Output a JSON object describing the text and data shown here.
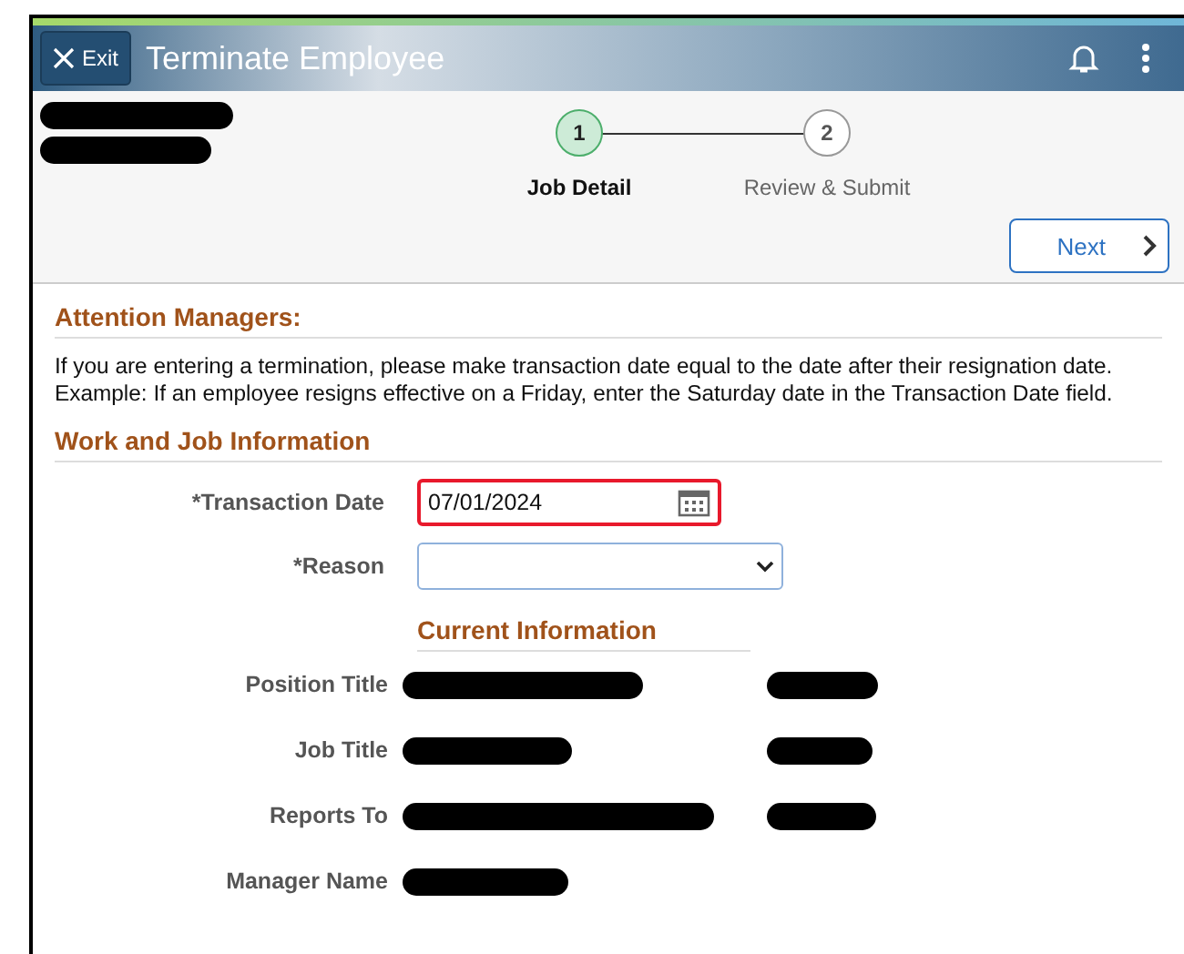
{
  "header": {
    "exit_label": "Exit",
    "title": "Terminate Employee"
  },
  "steps": [
    {
      "number": "1",
      "label": "Job Detail",
      "selected": true
    },
    {
      "number": "2",
      "label": "Review & Submit",
      "selected": false
    }
  ],
  "next_button": {
    "label": "Next"
  },
  "attention": {
    "heading": "Attention Managers:",
    "lines": [
      "If you are entering a termination, please make transaction date equal to the date after their resignation date.",
      "Example: If an employee resigns effective on a Friday, enter the Saturday date in the Transaction Date field."
    ]
  },
  "work_section": {
    "heading": "Work and Job Information",
    "fields": [
      {
        "kind": "date",
        "label": "*Transaction Date",
        "value": "07/01/2024",
        "error": true
      },
      {
        "kind": "select",
        "label": "*Reason",
        "error": false
      }
    ]
  },
  "current_info": {
    "heading": "Current Information",
    "rows": [
      {
        "label": "Position Title"
      },
      {
        "label": "Job Title"
      },
      {
        "label": "Reports To"
      },
      {
        "label": "Manager Name"
      }
    ]
  }
}
